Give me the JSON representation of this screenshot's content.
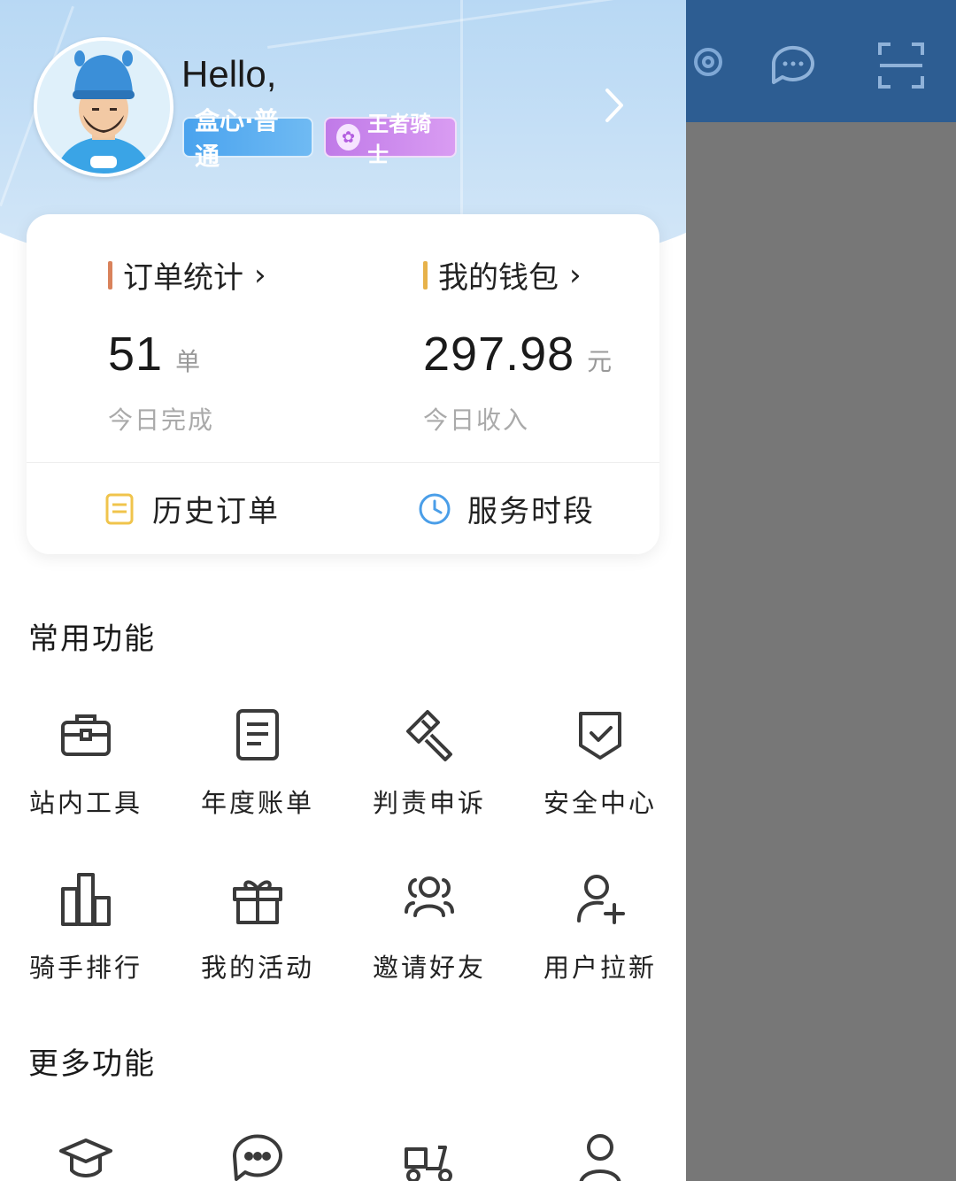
{
  "background_app": {
    "topbar_color": "#2d5d92",
    "icons": [
      "location-icon",
      "chat-icon",
      "scan-icon"
    ]
  },
  "profile": {
    "greeting": "Hello,",
    "level_badge": "盒心·普通",
    "rank_badge": "王者骑士"
  },
  "stats": {
    "orders": {
      "title": "订单统计",
      "value": "51",
      "unit": "单",
      "subtitle": "今日完成",
      "accent": "#d9825b"
    },
    "wallet": {
      "title": "我的钱包",
      "value": "297.98",
      "unit": "元",
      "subtitle": "今日收入",
      "accent": "#e7b24a"
    },
    "links": {
      "history": "历史订单",
      "service_time": "服务时段"
    }
  },
  "common_functions": {
    "title": "常用功能",
    "items": [
      {
        "label": "站内工具",
        "icon": "toolbox-icon"
      },
      {
        "label": "年度账单",
        "icon": "document-icon"
      },
      {
        "label": "判责申诉",
        "icon": "gavel-icon"
      },
      {
        "label": "安全中心",
        "icon": "shield-check-icon"
      },
      {
        "label": "骑手排行",
        "icon": "bar-chart-icon"
      },
      {
        "label": "我的活动",
        "icon": "gift-icon"
      },
      {
        "label": "邀请好友",
        "icon": "group-icon"
      },
      {
        "label": "用户拉新",
        "icon": "add-user-icon"
      }
    ]
  },
  "more_functions": {
    "title": "更多功能",
    "items": [
      {
        "icon": "graduation-cap-icon"
      },
      {
        "icon": "message-icon"
      },
      {
        "icon": "scooter-icon"
      },
      {
        "icon": "person-icon"
      }
    ]
  }
}
